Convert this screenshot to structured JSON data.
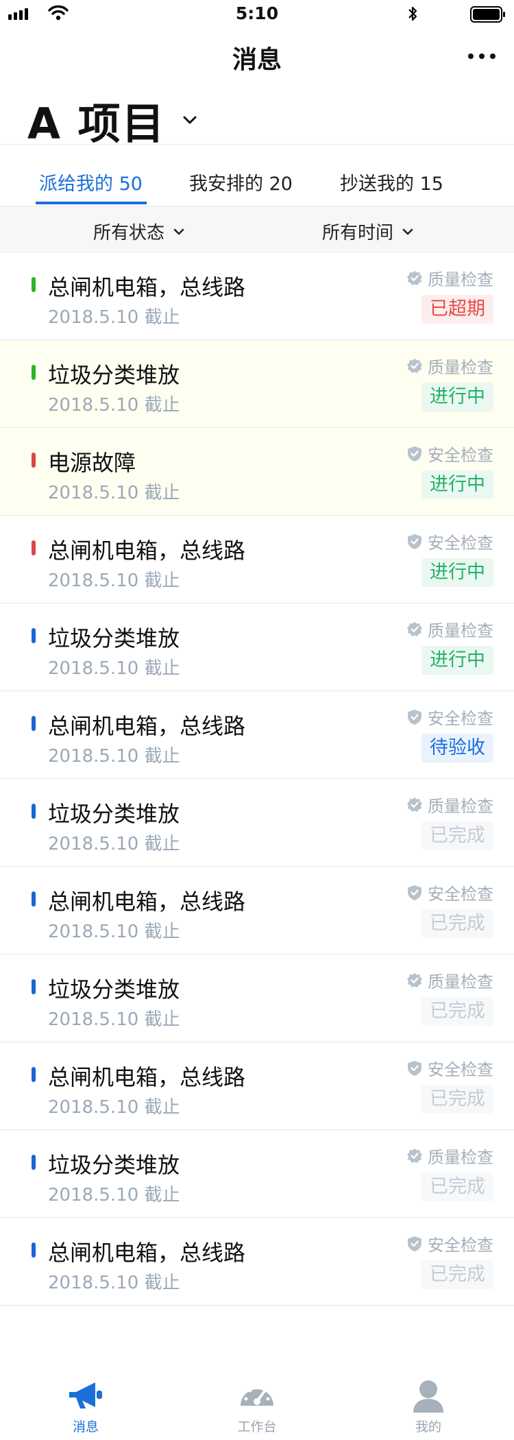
{
  "status_bar": {
    "time": "5:10"
  },
  "nav": {
    "title": "消息"
  },
  "project": {
    "name": "A 项目"
  },
  "tabs": [
    {
      "label": "派给我的 50"
    },
    {
      "label": "我安排的 20"
    },
    {
      "label": "抄送我的 15"
    }
  ],
  "filters": {
    "status": "所有状态",
    "time": "所有时间"
  },
  "colors": {
    "accent": "#1a6fd9",
    "bar_green": "#2bb526",
    "bar_red": "#e04545",
    "bar_blue": "#1a63d9",
    "highlight_row": "#fefef1"
  },
  "items": [
    {
      "title": "总闸机电箱，总线路",
      "deadline": "2018.5.10 截止",
      "category": "质量检查",
      "category_icon": "check-badge-icon",
      "status": "已超期",
      "status_type": "overdue",
      "bar": "green",
      "highlight": false
    },
    {
      "title": "垃圾分类堆放",
      "deadline": "2018.5.10 截止",
      "category": "质量检查",
      "category_icon": "check-badge-icon",
      "status": "进行中",
      "status_type": "progress",
      "bar": "green",
      "highlight": true
    },
    {
      "title": "电源故障",
      "deadline": "2018.5.10 截止",
      "category": "安全检查",
      "category_icon": "shield-icon",
      "status": "进行中",
      "status_type": "progress",
      "bar": "red",
      "highlight": true
    },
    {
      "title": "总闸机电箱，总线路",
      "deadline": "2018.5.10 截止",
      "category": "安全检查",
      "category_icon": "shield-icon",
      "status": "进行中",
      "status_type": "progress",
      "bar": "red",
      "highlight": false
    },
    {
      "title": "垃圾分类堆放",
      "deadline": "2018.5.10 截止",
      "category": "质量检查",
      "category_icon": "check-badge-icon",
      "status": "进行中",
      "status_type": "progress",
      "bar": "blue",
      "highlight": false
    },
    {
      "title": "总闸机电箱，总线路",
      "deadline": "2018.5.10 截止",
      "category": "安全检查",
      "category_icon": "shield-icon",
      "status": "待验收",
      "status_type": "pending",
      "bar": "blue",
      "highlight": false
    },
    {
      "title": "垃圾分类堆放",
      "deadline": "2018.5.10 截止",
      "category": "质量检查",
      "category_icon": "check-badge-icon",
      "status": "已完成",
      "status_type": "done",
      "bar": "blue",
      "highlight": false
    },
    {
      "title": "总闸机电箱，总线路",
      "deadline": "2018.5.10 截止",
      "category": "安全检查",
      "category_icon": "shield-icon",
      "status": "已完成",
      "status_type": "done",
      "bar": "blue",
      "highlight": false
    },
    {
      "title": "垃圾分类堆放",
      "deadline": "2018.5.10 截止",
      "category": "质量检查",
      "category_icon": "check-badge-icon",
      "status": "已完成",
      "status_type": "done",
      "bar": "blue",
      "highlight": false
    },
    {
      "title": "总闸机电箱，总线路",
      "deadline": "2018.5.10 截止",
      "category": "安全检查",
      "category_icon": "shield-icon",
      "status": "已完成",
      "status_type": "done",
      "bar": "blue",
      "highlight": false
    },
    {
      "title": "垃圾分类堆放",
      "deadline": "2018.5.10 截止",
      "category": "质量检查",
      "category_icon": "check-badge-icon",
      "status": "已完成",
      "status_type": "done",
      "bar": "blue",
      "highlight": false
    },
    {
      "title": "总闸机电箱，总线路",
      "deadline": "2018.5.10 截止",
      "category": "安全检查",
      "category_icon": "shield-icon",
      "status": "已完成",
      "status_type": "done",
      "bar": "blue",
      "highlight": false
    }
  ],
  "tabbar": [
    {
      "label": "消息",
      "icon": "megaphone-icon",
      "active": true
    },
    {
      "label": "工作台",
      "icon": "dashboard-gauge-icon",
      "active": false
    },
    {
      "label": "我的",
      "icon": "user-profile-icon",
      "active": false
    }
  ]
}
